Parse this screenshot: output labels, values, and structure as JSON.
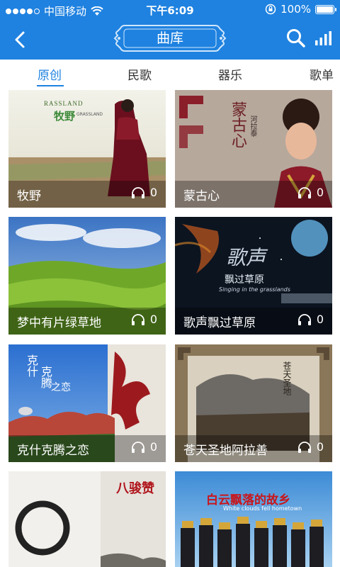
{
  "status_bar": {
    "carrier": "中国移动",
    "time": "下午6:09",
    "battery": "100%"
  },
  "header": {
    "title": "曲库",
    "back_icon": "back-chevron-icon",
    "search_icon": "search-icon",
    "chart_icon": "signal-bars-icon",
    "accent_color": "#1f82e0"
  },
  "tabs": [
    {
      "label": "原创",
      "active": true
    },
    {
      "label": "民歌",
      "active": false
    },
    {
      "label": "器乐",
      "active": false
    },
    {
      "label": "歌单",
      "active": false
    }
  ],
  "albums": [
    {
      "name": "牧野",
      "count": "0",
      "cover_text": [
        "RASSLAND",
        "牧野",
        "GRASSLAND"
      ]
    },
    {
      "name": "蒙古心",
      "count": "0",
      "cover_text": [
        "蒙古心",
        "河拉泰"
      ]
    },
    {
      "name": "梦中有片绿草地",
      "count": "0",
      "cover_text": []
    },
    {
      "name": "歌声飘过草原",
      "count": "0",
      "cover_text": [
        "歌声",
        "飘过草原",
        "Singing in the grasslands"
      ]
    },
    {
      "name": "克什克腾之恋",
      "count": "0",
      "cover_text": [
        "克什",
        "克腾",
        "之恋"
      ]
    },
    {
      "name": "苍天圣地阿拉善",
      "count": "0",
      "cover_text": [
        "苍天圣地"
      ]
    },
    {
      "name": "",
      "count": "",
      "cover_text": [
        "八骏赞"
      ]
    },
    {
      "name": "",
      "count": "",
      "cover_text": [
        "白云飘落的故乡",
        "White clouds fell hometown"
      ]
    }
  ]
}
